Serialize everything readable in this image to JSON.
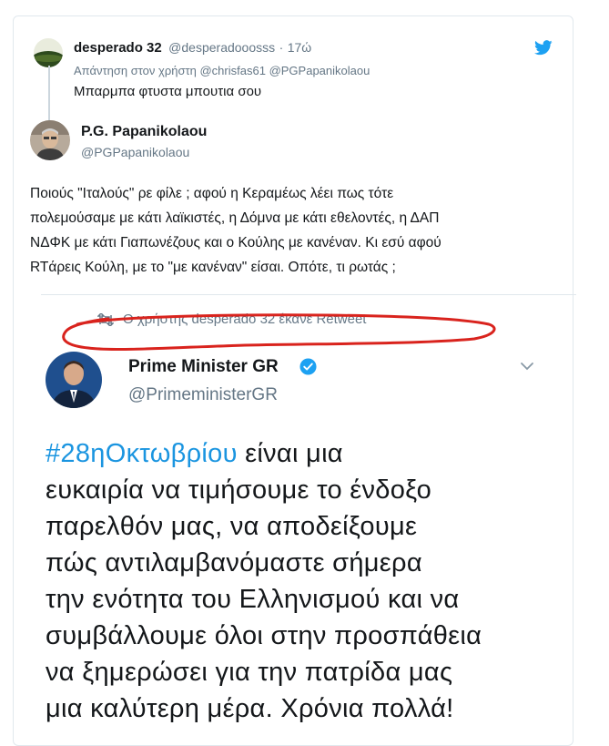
{
  "reply_tweet": {
    "display_name": "desperado 32",
    "handle": "@desperadooosss",
    "separator": "·",
    "time": "17ώ",
    "reply_to_prefix": "Απάντηση στον χρήστη",
    "reply_to_1": "@chrisfas61",
    "reply_to_2": "@PGPapanikolaou",
    "text": "Μπαρμπα φτυστα μπουτια σου"
  },
  "main_tweet": {
    "display_name": "P.G. Papanikolaou",
    "handle": "@PGPapanikolaou",
    "lines": [
      "Ποιούς \"Ιταλούς\" ρε φίλε ; αφού η Κεραμέως λέει πως τότε",
      "πολεμούσαμε με κάτι λαϊκιστές, η Δόμνα με κάτι εθελοντές, η ΔΑΠ",
      "ΝΔΦΚ με κάτι Γιαπωνέζους και ο Κούλης με κανέναν. Κι εσύ αφού",
      "RTάρεις Κούλη, με το \"με κανέναν\" είσαι. Οπότε, τι ρωτάς ;"
    ]
  },
  "retweet_notice": {
    "text": "Ο χρήστης desperado 32 έκανε Retweet"
  },
  "embedded_tweet": {
    "display_name": "Prime Minister GR",
    "handle": "@PrimeministerGR",
    "hashtag": "#28ηΟκτωβρίου",
    "line1_rest": " είναι μια",
    "lines": [
      "ευκαιρία να τιμήσουμε το ένδοξο",
      "παρελθόν μας, να αποδείξουμε",
      "πώς αντιλαμβανόμαστε σήμερα",
      "την ενότητα του Ελληνισμού και να",
      "συμβάλλουμε όλοι στην προσπάθεια",
      "να ξημερώσει για την πατρίδα μας",
      "μια καλύτερη μέρα. Χρόνια πολλά!"
    ]
  },
  "colors": {
    "twitter_blue": "#1da1f2",
    "hashtag_blue": "#1b95e0",
    "annotation_red": "#d9231d",
    "text": "#14171a",
    "muted": "#657786"
  },
  "icons": [
    "twitter-bird-icon",
    "retweet-icon",
    "verified-badge-icon",
    "chevron-down-icon"
  ]
}
